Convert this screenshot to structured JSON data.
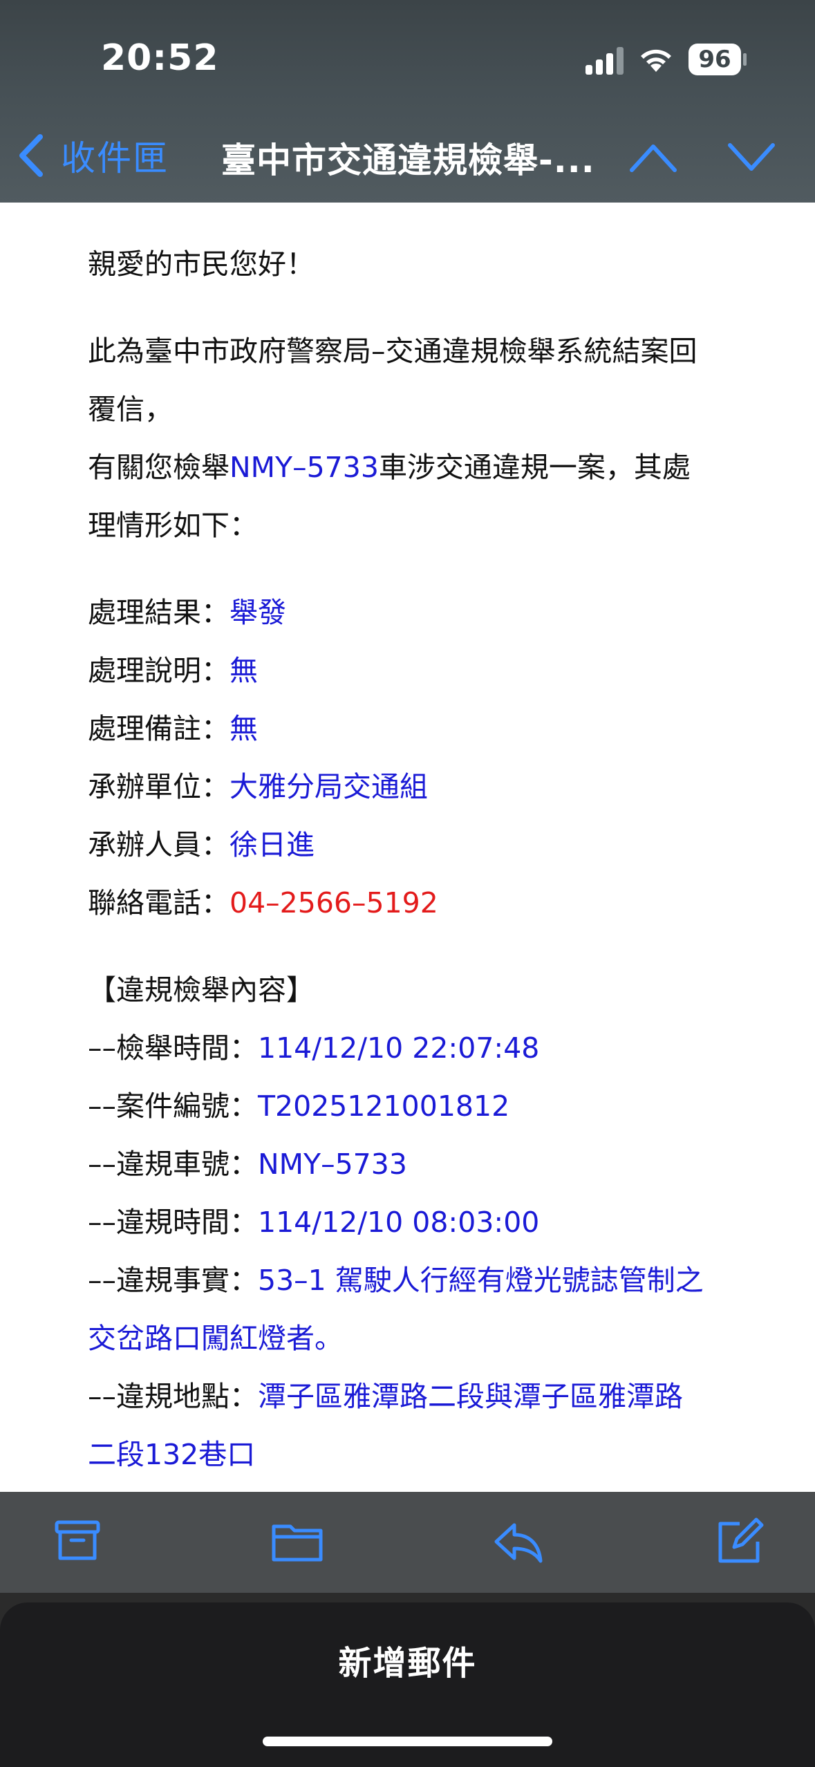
{
  "status_bar": {
    "time": "20:52",
    "battery": "96"
  },
  "nav": {
    "back_label": "收件匣",
    "title": "臺中市交通違規檢舉-..."
  },
  "colors": {
    "link_blue": "#1a1ad6",
    "phone_red": "#e31b1b",
    "accent": "#3a8cff"
  },
  "mail": {
    "greeting": "親愛的市民您好！",
    "intro_line1": "此為臺中市政府警察局–交通違規檢舉系統結案回",
    "intro_line2": "覆信，",
    "case_prefix": "有關您檢舉",
    "case_plate": "NMY–5733",
    "case_suffix": "車涉交通違規一案，其處",
    "case_line2": "理情形如下：",
    "result": [
      {
        "label": "處理結果：",
        "value": "舉發"
      },
      {
        "label": "處理說明：",
        "value": "無"
      },
      {
        "label": "處理備註：",
        "value": "無"
      },
      {
        "label": "承辦單位：",
        "value": "大雅分局交通組"
      },
      {
        "label": "承辦人員：",
        "value": "徐日進"
      },
      {
        "label": "聯絡電話：",
        "value": "04–2566–5192"
      }
    ],
    "section_title": "【違規檢舉內容】",
    "details": [
      {
        "label": "––檢舉時間：",
        "value": "114/12/10 22:07:48"
      },
      {
        "label": "––案件編號：",
        "value": "T2025121001812"
      },
      {
        "label": "––違規車號：",
        "value": "NMY–5733"
      },
      {
        "label": "––違規時間：",
        "value": "114/12/10 08:03:00"
      },
      {
        "label": "––違規事實：",
        "value": "53–1 駕駛人行經有燈光號誌管制之",
        "value_line2": "交岔路口闖紅燈者。"
      },
      {
        "label": "––違規地點：",
        "value": "潭子區雅潭路二段與潭子區雅潭路",
        "value_line2": "二段132巷口"
      }
    ]
  },
  "toolbar": {
    "icons": [
      "archive-icon",
      "folder-icon",
      "reply-icon",
      "compose-icon"
    ]
  },
  "new_mail": {
    "label": "新增郵件"
  }
}
